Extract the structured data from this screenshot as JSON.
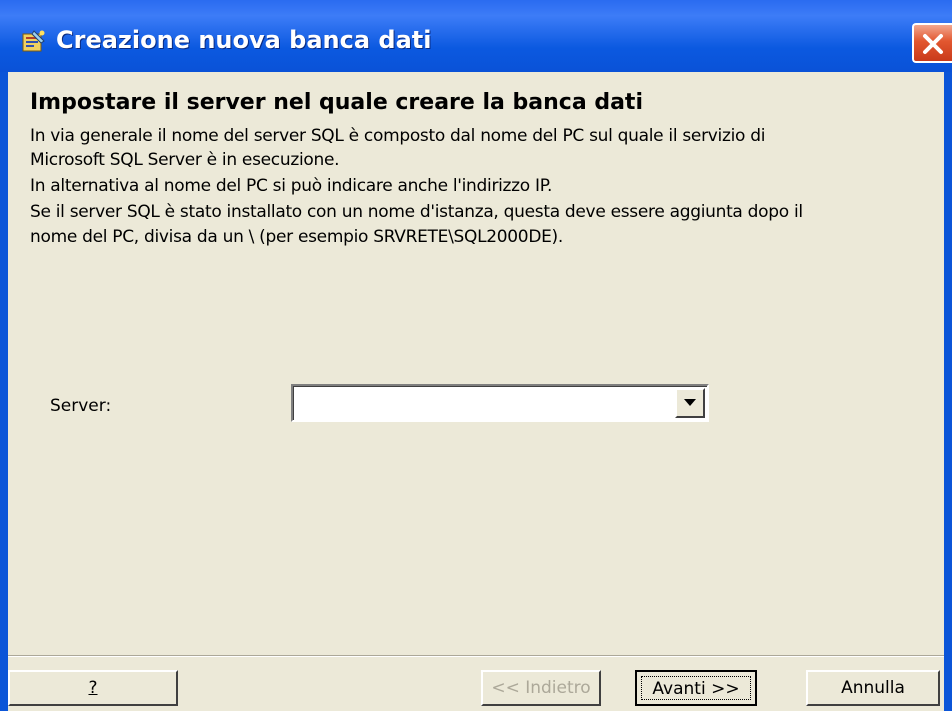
{
  "window": {
    "title": "Creazione nuova banca dati",
    "app_icon": "wizard-app-icon",
    "close_icon": "close-icon"
  },
  "content": {
    "heading": "Impostare il server nel quale creare la banca dati",
    "description_lines": [
      "In via generale il nome del server SQL è composto dal nome del PC sul quale il servizio di",
      "Microsoft SQL Server è in esecuzione.",
      "In alternativa al nome del PC si può indicare anche l'indirizzo IP.",
      "Se il server SQL è stato installato con un nome d'istanza, questa deve essere aggiunta dopo il",
      "nome del PC, divisa da un \\ (per esempio SRVRETE\\SQL2000DE)."
    ],
    "server_label": "Server:",
    "server_value": "",
    "dropdown_icon": "chevron-down-icon"
  },
  "buttons": {
    "help": "?",
    "back": "<< Indietro",
    "next": "Avanti >>",
    "cancel": "Annulla"
  },
  "colors": {
    "titlebar": "#0b59e0",
    "face": "#ece9d8",
    "close": "#e2572f",
    "disabled_text": "#aca899"
  }
}
